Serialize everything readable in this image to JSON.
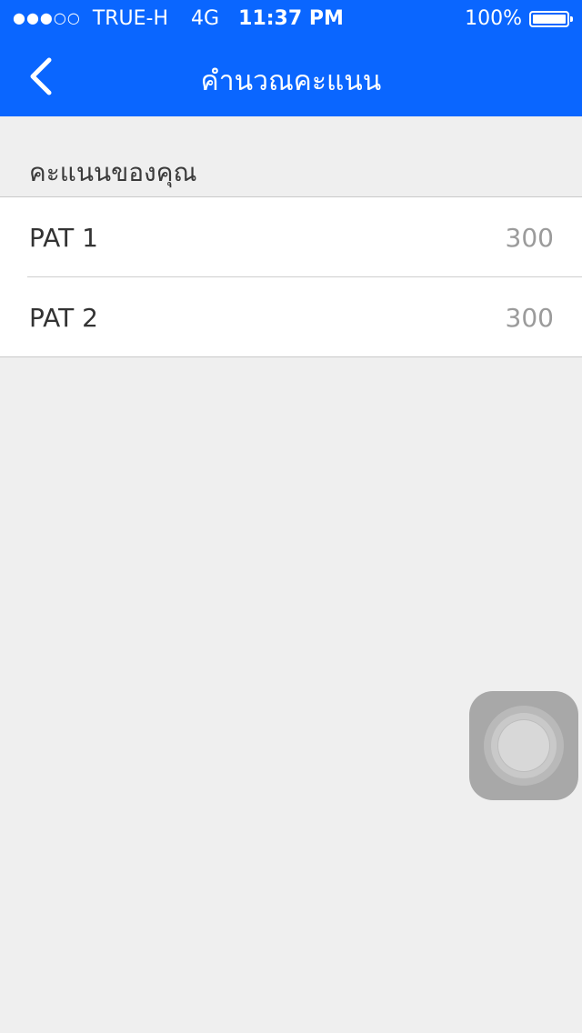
{
  "status_bar": {
    "signal": "●●●○○",
    "carrier": "TRUE-H",
    "network": "4G",
    "time": "11:37 PM",
    "battery": "100%",
    "battery_level": 1.0
  },
  "navbar": {
    "title": "คำนวณคะแนน",
    "back_icon": "chevron-left-icon"
  },
  "section": {
    "header": "คะแนนของคุณ"
  },
  "scores": [
    {
      "label": "PAT 1",
      "value": "300"
    },
    {
      "label": "PAT 2",
      "value": "300"
    }
  ],
  "colors": {
    "accent": "#0a66ff",
    "background": "#efefef",
    "value_text": "#9b9b9b"
  }
}
